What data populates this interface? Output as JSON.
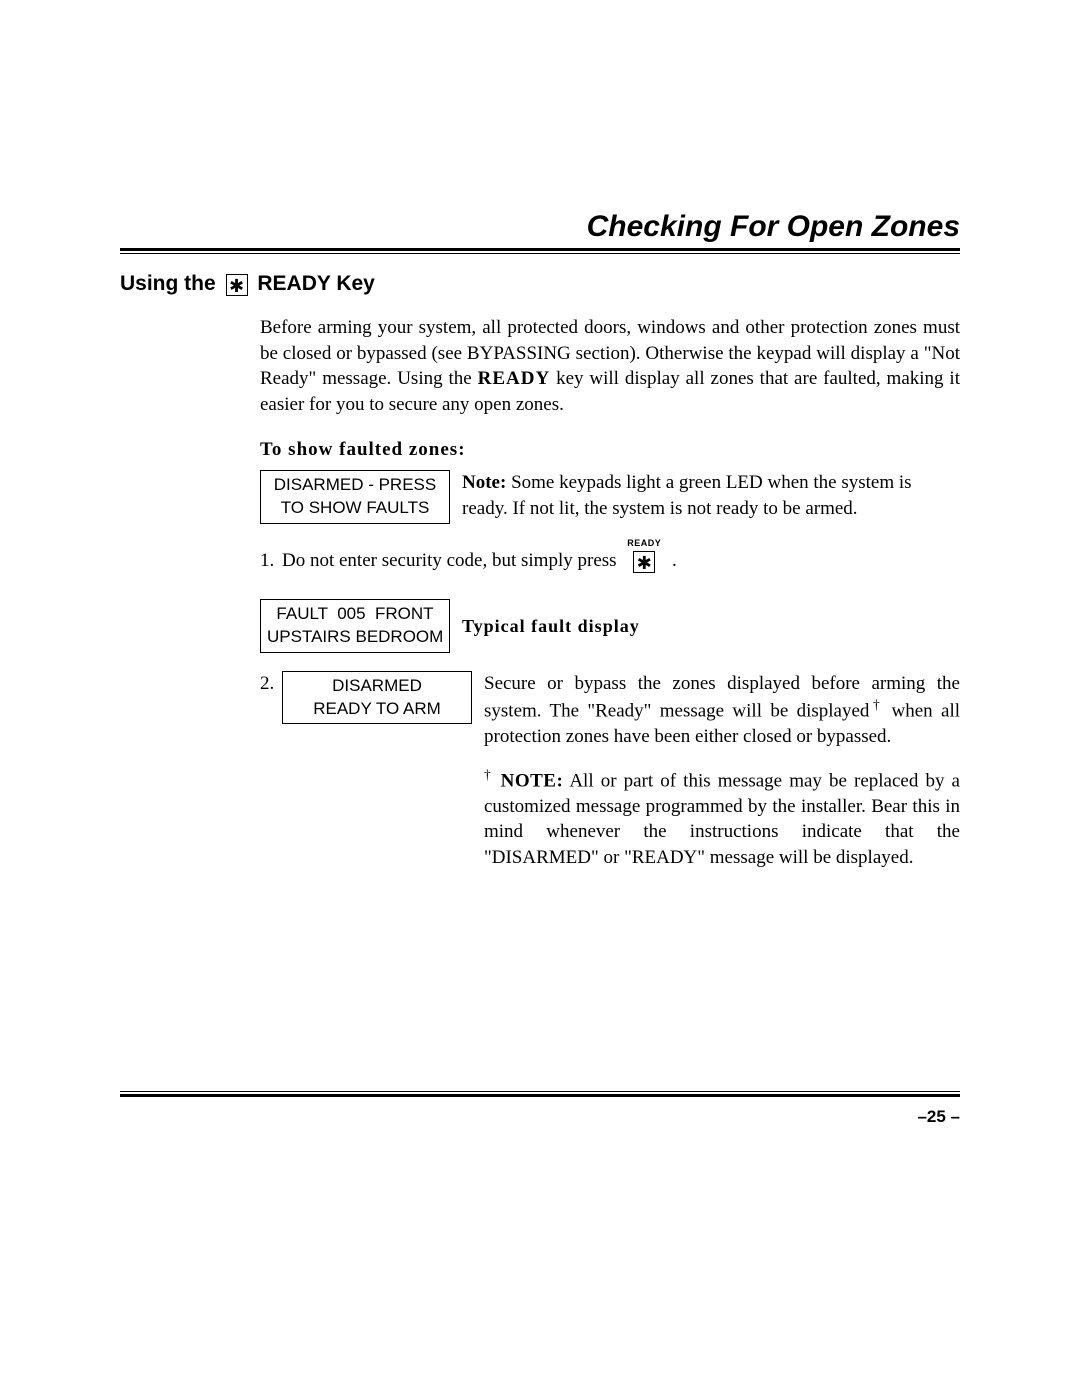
{
  "title": "Checking For Open Zones",
  "subhead_pre": "Using the ",
  "subhead_key": "✱",
  "subhead_post": "  READY Key",
  "intro_a": "Before arming your system, all protected doors, windows and other protection zones must be closed or bypassed (see BYPASSING section).  Otherwise the keypad will display a \"Not Ready\" message. Using the ",
  "intro_key": "READY",
  "intro_b": " key will display all zones that are faulted, making it easier for you to secure any open zones.",
  "section_label": "To show faulted zones:",
  "lcd1_line1": "DISARMED - PRESS",
  "lcd1_line2": "TO SHOW FAULTS",
  "note_label": "Note:",
  "note_text": " Some keypads light a green LED when the system is ready. If not lit, the system is not ready to be armed.",
  "step1_num": "1.",
  "step1_text": "Do not enter security code, but simply press",
  "step1_key_label": "READY",
  "step1_key": "✱",
  "step1_after": ".",
  "lcd2_line1": "FAULT  005  FRONT",
  "lcd2_line2": "UPSTAIRS BEDROOM",
  "fault_label": "Typical fault display",
  "step2_num": "2.",
  "lcd3_line1": "DISARMED",
  "lcd3_line2": "READY TO ARM",
  "step2_text_a": "Secure or bypass the zones displayed before arming the system. The \"Ready\" message will be displayed",
  "step2_dagger": "†",
  "step2_text_b": " when all protection zones have been either closed or bypassed.",
  "footnote_dagger": "†",
  "footnote_label": " NOTE:",
  "footnote_text": " All or part of this message may be replaced by a customized message programmed by the installer.  Bear this in mind whenever the instructions indicate that the \"DISARMED\" or \"READY\" message will be displayed.",
  "page_number": "–25 –"
}
